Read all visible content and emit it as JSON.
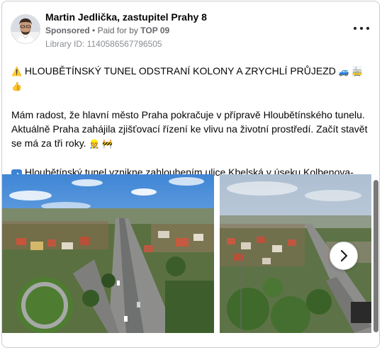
{
  "post": {
    "author": "Martin Jedlička, zastupitel Prahy 8",
    "sponsored_label": "Sponsored",
    "separator": "•",
    "paid_for_by_label": "Paid for by",
    "paid_for_by_name": "TOP 09",
    "library_id": "Library ID: 1140586567796505",
    "more_options_icon": "more-horizontal-icon"
  },
  "content": {
    "headline_icon": "⚠️",
    "headline": "HLOUBĚTÍNSKÝ TUNEL ODSTRANÍ KOLONY A ZRYCHLÍ PRŮJEZD",
    "headline_emojis": "🚙 🚋 👍",
    "paragraph": "Mám radost, že hlavní město Praha pokračuje v přípravě Hloubětínského tunelu. Aktuálně Praha zahájila zjišťovací řízení ke vlivu na životní prostředí. Začít stavět se má za tři roky.",
    "paragraph_emojis": "👷 🚧",
    "bullet_icon": "➡️",
    "bullet_text": "Hloubětínský tunel vznikne zahloubením ulice Kbelská v úseku Kolbenova-..."
  },
  "carousel": {
    "slide_1": "aerial-photo-highway-tunnel-prague",
    "slide_2": "aerial-photo-city-tunnel-portal",
    "next_icon": "chevron-right-icon"
  },
  "colors": {
    "text": "#050505",
    "secondary_text": "#65676b",
    "border": "#c9ccd1"
  }
}
